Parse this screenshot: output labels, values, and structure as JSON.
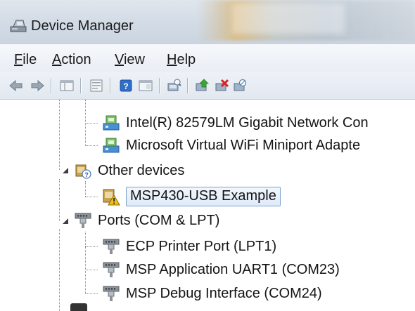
{
  "window": {
    "title": "Device Manager",
    "icon": "device-manager-icon"
  },
  "menu": {
    "items": [
      {
        "label": "File",
        "name": "menu-file"
      },
      {
        "label": "Action",
        "name": "menu-action"
      },
      {
        "label": "View",
        "name": "menu-view"
      },
      {
        "label": "Help",
        "name": "menu-help"
      }
    ]
  },
  "toolbar": {
    "buttons": [
      {
        "icon": "back-arrow-icon"
      },
      {
        "icon": "forward-arrow-icon"
      },
      {
        "icon": "show-hide-console-tree-icon"
      },
      {
        "icon": "properties-icon"
      },
      {
        "icon": "help-icon"
      },
      {
        "icon": "view-icon"
      },
      {
        "icon": "scan-hardware-changes-icon"
      },
      {
        "icon": "update-driver-icon"
      },
      {
        "icon": "uninstall-icon"
      },
      {
        "icon": "disable-device-icon"
      }
    ]
  },
  "tree": {
    "network_items": [
      "Intel(R) 82579LM Gigabit Network Con",
      "Microsoft Virtual WiFi Miniport Adapte"
    ],
    "other_devices": {
      "label": "Other devices",
      "children": [
        "MSP430-USB Example"
      ],
      "selected": "MSP430-USB Example"
    },
    "ports": {
      "label": "Ports (COM & LPT)",
      "children": [
        "ECP Printer Port (LPT1)",
        "MSP Application UART1 (COM23)",
        "MSP Debug Interface (COM24)"
      ]
    }
  },
  "colors": {
    "title_bar": "#d3dce6",
    "selection_border": "#7da2ce",
    "selection_fill": "#dfeafa"
  }
}
